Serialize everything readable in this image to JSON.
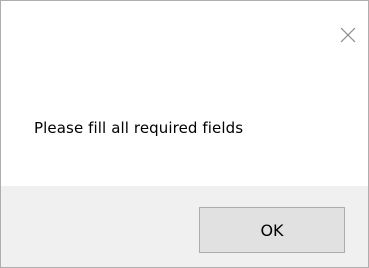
{
  "dialog": {
    "message": "Please fill all required fields",
    "ok_label": "OK",
    "close_icon": "close-icon"
  },
  "colors": {
    "footer_bg": "#f0f0f0",
    "button_bg": "#e1e1e1",
    "button_border": "#adadad",
    "window_border": "#aeaeae"
  }
}
